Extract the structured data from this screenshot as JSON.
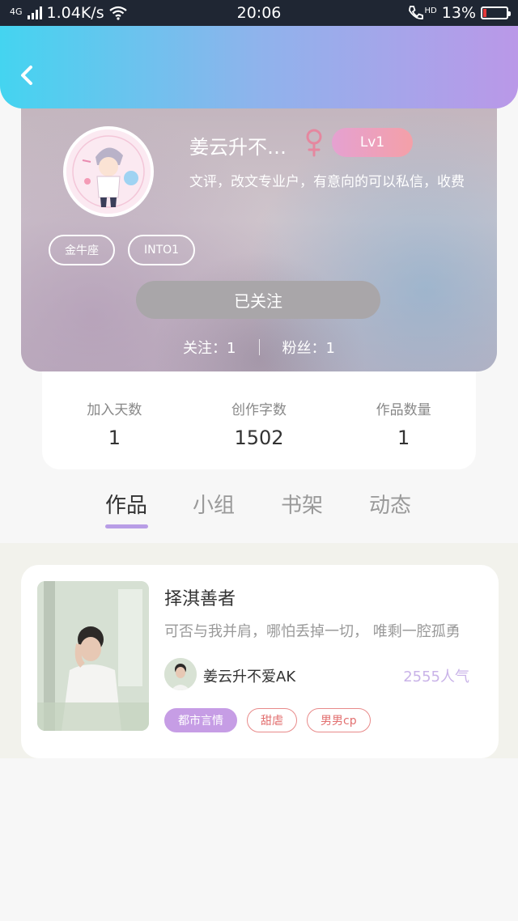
{
  "status_bar": {
    "network_type": "4G",
    "speed": "1.04K/s",
    "time": "20:06",
    "hd_label": "HD",
    "battery": "13%",
    "battery_level": 0.13
  },
  "profile": {
    "username": "姜云升不爱AK",
    "level": "Lv1",
    "bio": "文评，改文专业户，有意向的可以私信，收费",
    "tags": [
      "金牛座",
      "INTO1"
    ],
    "follow_button": "已关注",
    "following_label": "关注：1",
    "followers_label": "粉丝：1"
  },
  "stats": [
    {
      "label": "加入天数",
      "value": "1"
    },
    {
      "label": "创作字数",
      "value": "1502"
    },
    {
      "label": "作品数量",
      "value": "1"
    }
  ],
  "tabs": [
    "作品",
    "小组",
    "书架",
    "动态"
  ],
  "active_tab": 0,
  "work": {
    "title": "择淇善者",
    "description": "可否与我并肩，哪怕丢掉一切， 唯剩一腔孤勇",
    "author": "姜云升不爱AK",
    "popularity": "2555人气",
    "tags": [
      "都市言情",
      "甜虐",
      "男男cp"
    ]
  },
  "colors": {
    "header_gradient": [
      "#44d4f0",
      "#ba98e8"
    ],
    "level_badge": "#e5a1d1",
    "gender_icon": "#e5879f",
    "tab_indicator": "#b89de6",
    "popularity": "#c9b3e8",
    "tag_filled": "#c69de5",
    "tag_outline": "#e88a8a"
  },
  "icons": {
    "back": "chevron-left-icon",
    "gender": "female-icon",
    "signal": "signal-icon",
    "wifi": "wifi-icon",
    "phone": "phone-icon",
    "battery": "battery-icon"
  }
}
